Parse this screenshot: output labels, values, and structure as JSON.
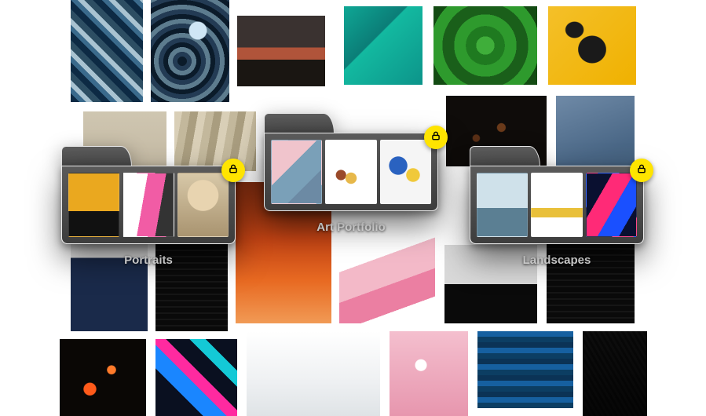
{
  "folders": [
    {
      "key": "portraits",
      "label": "Portraits",
      "locked": true,
      "thumbs": [
        "mannequin-yellow-jacket",
        "people-pink-fabric",
        "woman-sunglasses"
      ]
    },
    {
      "key": "art",
      "label": "Art Portfolio",
      "locked": true,
      "thumbs": [
        "pastel-collage",
        "cone-shapes-white",
        "spheres-still-life"
      ]
    },
    {
      "key": "landscapes",
      "label": "Landscapes",
      "locked": true,
      "thumbs": [
        "umbrella-minimal",
        "arches-yellow",
        "abstract-neon-light"
      ]
    }
  ],
  "background_tiles": [
    "geometric-crystal",
    "blue-marble-swirl",
    "ocean-sunset",
    "teal-folded-fabric",
    "green-fern",
    "yellow-abstract-object",
    "beige-sand",
    "sand-ripples",
    "dark-embers",
    "blue-paper",
    "orange-red-blur",
    "pink-white-streaks",
    "black-white-horizon",
    "lava-dark",
    "glitch-blue-pink",
    "white-clouds",
    "pink-clouds",
    "blue-wave-panel",
    "building-corner",
    "navy-minimal",
    "night-lines"
  ],
  "icons": {
    "lock": "lock-icon"
  }
}
